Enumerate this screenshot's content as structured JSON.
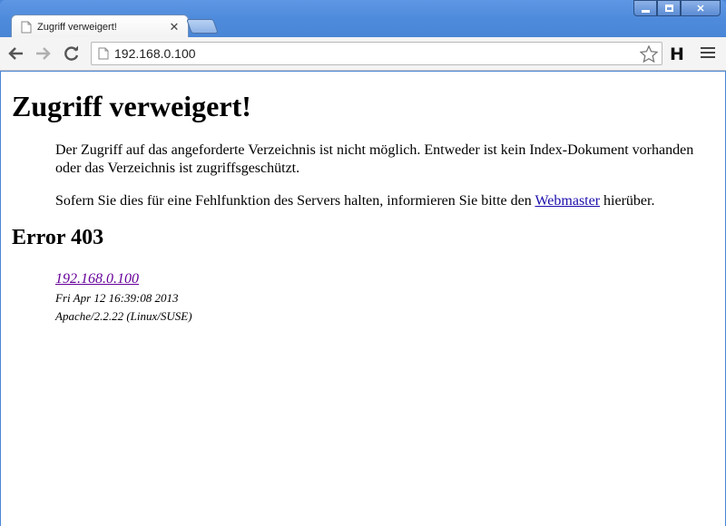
{
  "browser": {
    "tab": {
      "title": "Zugriff verweigert!"
    },
    "address_bar": {
      "url": "192.168.0.100"
    },
    "extension_label": "H",
    "colors": {
      "frame": "#4a86d8",
      "toolbar": "#f4f4f4"
    }
  },
  "page": {
    "heading": "Zugriff verweigert!",
    "paragraph1": "Der Zugriff auf das angeforderte Verzeichnis ist nicht möglich. Entweder ist kein Index-Dokument vorhanden oder das Verzeichnis ist zugriffsgeschützt.",
    "paragraph2_before": "Sofern Sie dies für eine Fehlfunktion des Servers halten, informieren Sie bitte den ",
    "paragraph2_link": "Webmaster",
    "paragraph2_after": " hierüber.",
    "error_title": "Error 403",
    "address": {
      "host": "192.168.0.100",
      "date": "Fri Apr 12 16:39:08 2013",
      "server": "Apache/2.2.22 (Linux/SUSE)"
    }
  },
  "icons": [
    "page-icon",
    "close-icon",
    "back-icon",
    "forward-icon",
    "reload-icon",
    "star-icon",
    "menu-icon"
  ]
}
